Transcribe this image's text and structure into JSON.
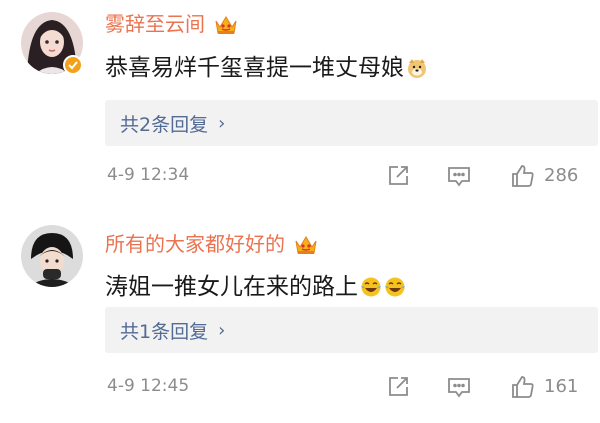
{
  "comments": [
    {
      "username": "雾辞至云间",
      "text": "恭喜易烊千玺喜提一堆丈母娘",
      "replies_label": "共2条回复",
      "time": "4-9 12:34",
      "likes": "286"
    },
    {
      "username": "所有的大家都好好的",
      "text": "涛姐一推女儿在来的路上",
      "replies_label": "共1条回复",
      "time": "4-9 12:45",
      "likes": "161"
    }
  ],
  "ui": {
    "chevron": "›",
    "icons": [
      "verified-badge-icon",
      "vip-crown-icon",
      "doge-emoji-icon",
      "crying-laugh-emoji-icon",
      "share-icon",
      "comment-icon",
      "like-icon"
    ]
  },
  "colors": {
    "username": "#eb7350",
    "reply_link": "#526b94",
    "reply_box_bg": "#f2f2f2",
    "meta_gray": "#8c8c8c",
    "verified": "#f2a21a"
  }
}
